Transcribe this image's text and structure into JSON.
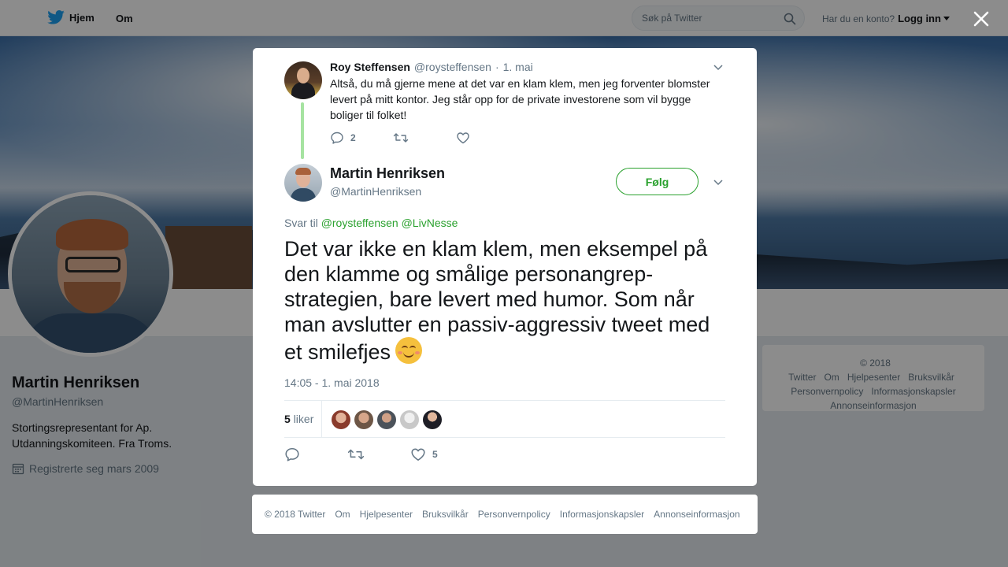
{
  "nav": {
    "home_label": "Hjem",
    "about_label": "Om",
    "search_placeholder": "Søk på Twitter",
    "account_prompt": "Har du en konto?",
    "login_label": "Logg inn"
  },
  "profile": {
    "name": "Martin Henriksen",
    "handle": "@MartinHenriksen",
    "bio": "Stortingsrepresentant for Ap. Utdanningskomiteen. Fra Troms.",
    "joined": "Registrerte seg mars 2009"
  },
  "side_footer": {
    "links": [
      "© 2018 Twitter",
      "Om",
      "Hjelpesenter",
      "Bruksvilkår",
      "Personvernpolicy",
      "Informasjonskapsler",
      "Annonseinformasjon"
    ]
  },
  "parent_tweet": {
    "name": "Roy Steffensen",
    "handle": "@roysteffensen",
    "separator": "·",
    "date": "1. mai",
    "text": "Altså, du må gjerne mene at det var en klam klem, men jeg forventer blomster levert på mitt kontor. Jeg står opp for de private investorene som vil bygge boliger til folket!",
    "reply_count": "2"
  },
  "main_tweet": {
    "name": "Martin Henriksen",
    "handle": "@MartinHenriksen",
    "follow_label": "Følg",
    "reply_to_prefix": "Svar til",
    "reply_mentions": [
      "@roysteffensen",
      "@LivNesse"
    ],
    "text": "Det var ikke en klam klem, men eksempel på den klamme og smålige personangrep-strategien, bare levert med humor. Som når man avslutter en passiv-aggressiv tweet med et smilefjes",
    "emoji": "smiling-face-with-smiling-eyes",
    "timestamp": "14:05 - 1. mai 2018",
    "likes_number": "5",
    "likes_word": "liker",
    "like_count": "5",
    "likers": [
      "#b5654a",
      "#8a6d5b",
      "#5b6470",
      "#d8d8d8",
      "#2a2a33"
    ]
  },
  "modal_footer": {
    "links": [
      "© 2018 Twitter",
      "Om",
      "Hjelpesenter",
      "Bruksvilkår",
      "Personvernpolicy",
      "Informasjonskapsler",
      "Annonseinformasjon"
    ]
  },
  "colors": {
    "accent": "#2aa12e",
    "brand_bird": "#1da1f2",
    "thread_line": "#a6e3a1",
    "muted": "#657786"
  }
}
